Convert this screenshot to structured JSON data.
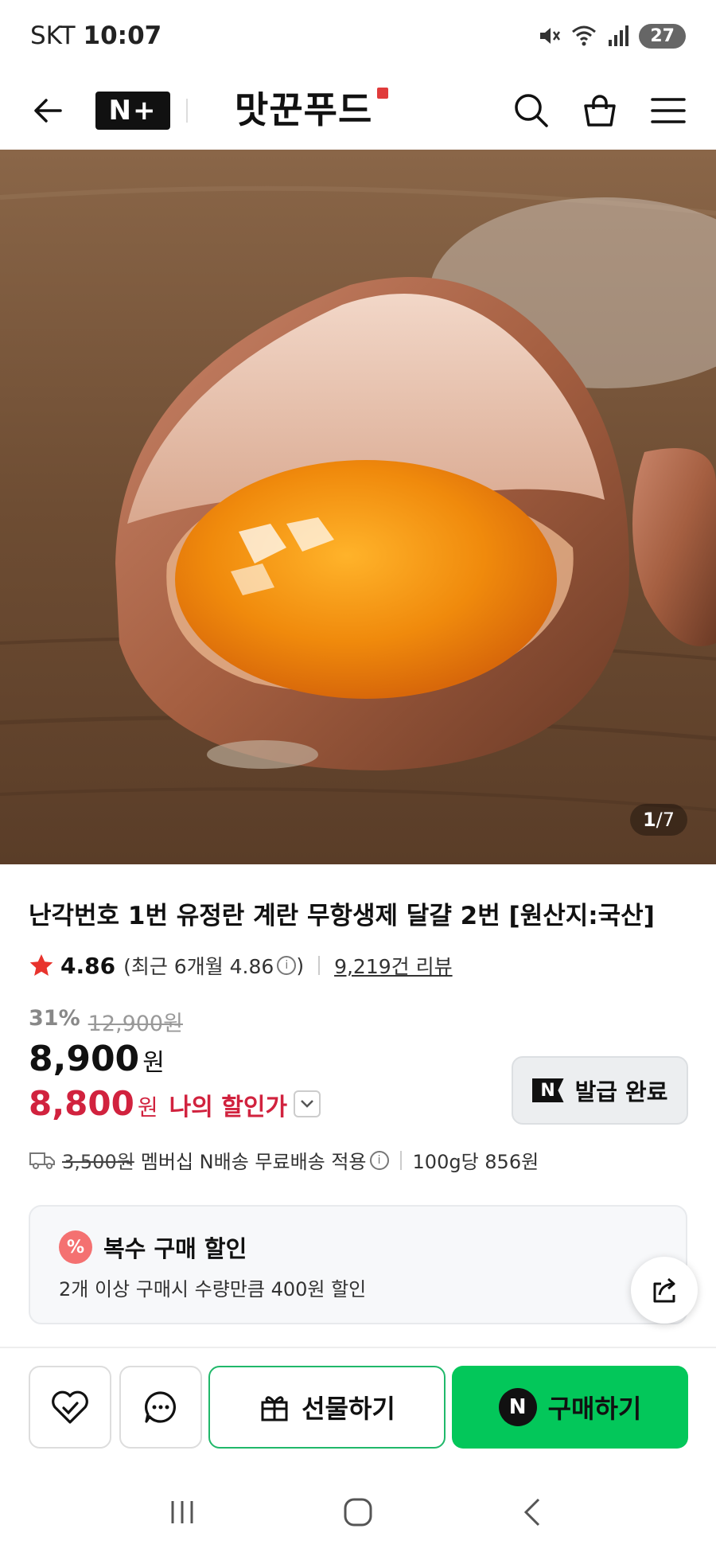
{
  "status_bar": {
    "carrier": "SKT",
    "time": "10:07",
    "battery": "27"
  },
  "header": {
    "back_icon": "arrow-left-icon",
    "nplus_label": "N+",
    "brand": "맛꾼푸드",
    "icons": [
      "search-icon",
      "shopping-bag-icon",
      "menu-icon"
    ]
  },
  "hero": {
    "pager_current": "1",
    "pager_total": "/7"
  },
  "product": {
    "title": "난각번호 1번 유정란 계란 무항생제 달걀 2번 [원산지:국산]",
    "rating": "4.86",
    "recent_rating": "(최근 6개월 4.86",
    "recent_close": ")",
    "review_count": "9,219건 리뷰",
    "discount_pct": "31%",
    "original_price": "12,900원",
    "price": "8,900",
    "price_unit": "원",
    "my_price": "8,800",
    "my_price_unit": "원",
    "my_price_label": "나의 할인가",
    "coupon_badge": "N",
    "coupon_label": "발급 완료"
  },
  "shipping": {
    "fee": "3,500원",
    "text": "멤버십 N배송 무료배송 적용",
    "unit_price": "100g당 856원"
  },
  "promo": {
    "badge": "%",
    "title": "복수 구매 할인",
    "desc": "2개 이상 구매시 수량만큼 400원 할인"
  },
  "actions": {
    "gift_label": "선물하기",
    "buy_badge": "N",
    "buy_label": "구매하기"
  },
  "colors": {
    "buy_green": "#03c75a",
    "sale_red": "#d1223e",
    "gift_border": "#20b86a"
  }
}
